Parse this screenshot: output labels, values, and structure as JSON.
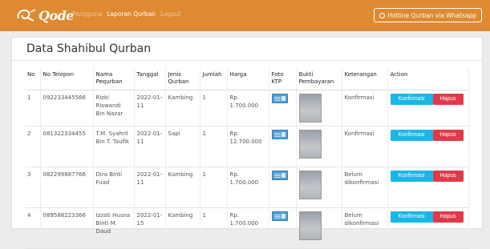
{
  "navbar": {
    "logo_text": "Qode",
    "links": [
      "Pengguna",
      "Laporan Qurban",
      "Logout"
    ],
    "active_index": 1,
    "hotline_label": "Hotline Qurban via Whatsapp",
    "bg_color": "#dd8a32"
  },
  "page": {
    "title": "Data Shahibul Qurban"
  },
  "table": {
    "headers": [
      "No",
      "No Telepon",
      "Nama Pequrban",
      "Tanggal",
      "Jenis Qurban",
      "Jumlah",
      "Harga",
      "Foto KTP",
      "Bukti Pembayaran",
      "Keterangan",
      "Action"
    ],
    "rows": [
      {
        "no": "1",
        "telepon": "092233445566",
        "nama": "Rizki Riswandi Bin Nazar",
        "tanggal": "2022-01-11",
        "jenis": "Kambing",
        "jumlah": "1",
        "harga": "Rp. 1.700.000",
        "keterangan": "Konfirmasi"
      },
      {
        "no": "2",
        "telepon": "081322334455",
        "nama": "T.M. Syahril Bin T. Taufik",
        "tanggal": "2022-01-11",
        "jenis": "Sapi",
        "jumlah": "1",
        "harga": "Rp. 12.700.000",
        "keterangan": "Konfirmasi"
      },
      {
        "no": "3",
        "telepon": "082299887766",
        "nama": "Dira Binti Fuad",
        "tanggal": "2022-01-11",
        "jenis": "Kambing",
        "jumlah": "1",
        "harga": "Rp. 1.700.000",
        "keterangan": "Belum dikonfirmasi"
      },
      {
        "no": "4",
        "telepon": "089588223366",
        "nama": "Izzati Husna Binti M. Daud",
        "tanggal": "2022-01-15",
        "jenis": "Kambing",
        "jumlah": "1",
        "harga": "Rp. 1.700.000",
        "keterangan": "Belum dikonfirmasi"
      }
    ],
    "action_labels": {
      "confirm": "Konfirmasi",
      "delete": "Hapus"
    },
    "colors": {
      "confirm": "#1ab7e6",
      "delete": "#e03a4a"
    }
  }
}
